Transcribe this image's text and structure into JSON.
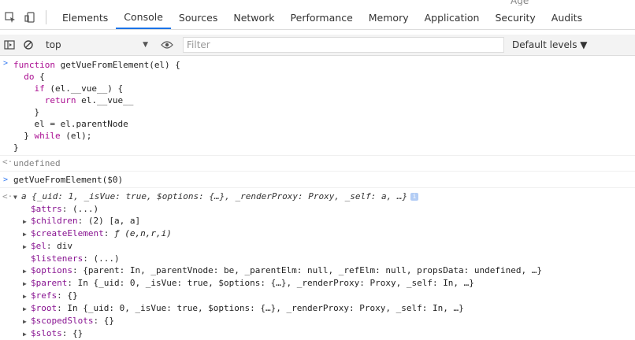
{
  "topbar": {
    "age_clip": "Age",
    "tabs": [
      "Elements",
      "Console",
      "Sources",
      "Network",
      "Performance",
      "Memory",
      "Application",
      "Security",
      "Audits"
    ],
    "active_tab": "Console"
  },
  "toolbar": {
    "context": "top",
    "filter_placeholder": "Filter",
    "levels": "Default levels ▼"
  },
  "console": {
    "input1_lines": [
      "function getVueFromElement(el) {",
      "  do {",
      "    if (el.__vue__) {",
      "      return el.__vue__",
      "    }",
      "    el = el.parentNode",
      "  } while (el);",
      "}"
    ],
    "result1": "undefined",
    "input2": "getVueFromElement($0)",
    "object_header": "a {_uid: 1, _isVue: true, $options: {…}, _renderProxy: Proxy, _self: a, …}",
    "properties": [
      {
        "key": "$attrs",
        "value": "(...)",
        "expandable": false
      },
      {
        "key": "$children",
        "value": "(2) [a, a]",
        "expandable": true
      },
      {
        "key": "$createElement",
        "value": "ƒ (e,n,r,i)",
        "expandable": true
      },
      {
        "key": "$el",
        "value": "div",
        "expandable": true
      },
      {
        "key": "$listeners",
        "value": "(...)",
        "expandable": false
      },
      {
        "key": "$options",
        "value": "{parent: In, _parentVnode: be, _parentElm: null, _refElm: null, propsData: undefined, …}",
        "expandable": true
      },
      {
        "key": "$parent",
        "value": "In {_uid: 0, _isVue: true, $options: {…}, _renderProxy: Proxy, _self: In, …}",
        "expandable": true
      },
      {
        "key": "$refs",
        "value": "{}",
        "expandable": true
      },
      {
        "key": "$root",
        "value": "In {_uid: 0, _isVue: true, $options: {…}, _renderProxy: Proxy, _self: In, …}",
        "expandable": true
      },
      {
        "key": "$scopedSlots",
        "value": "{}",
        "expandable": true
      },
      {
        "key": "$slots",
        "value": "{}",
        "expandable": true
      }
    ],
    "info_badge": "i"
  },
  "colors": {
    "accent": "#1a73e8",
    "keyword": "#aa0d91",
    "property": "#881391",
    "prompt": "#367cf1"
  }
}
